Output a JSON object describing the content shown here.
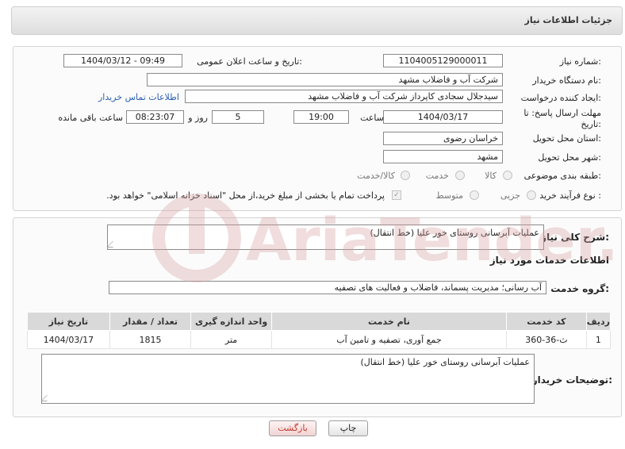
{
  "header": {
    "title": "جزئیات اطلاعات نیاز"
  },
  "form": {
    "need_number_label": "شماره نیاز:",
    "need_number": "1104005129000011",
    "announce_label": "تاریخ و ساعت اعلان عمومی:",
    "announce_value": "1404/03/12 - 09:49",
    "buyer_org_label": "نام دستگاه خریدار:",
    "buyer_org": "شرکت آب و فاضلاب مشهد",
    "creator_label": "ایجاد کننده درخواست:",
    "creator": "سیدجلال سجادی کاپرداز شرکت آب و فاضلاب مشهد",
    "contact_link": "اطلاعات تماس خریدار",
    "deadline_label_1": "مهلت ارسال پاسخ: تا",
    "deadline_label_2": "تاریخ:",
    "deadline_date": "1404/03/17",
    "time_label": "ساعت",
    "deadline_time": "19:00",
    "days_value": "5",
    "days_label": "روز و",
    "remaining_time": "08:23:07",
    "remaining_label": "ساعت باقی مانده",
    "province_label": "استان محل تحویل:",
    "province": "خراسان رضوی",
    "city_label": "شهر محل تحویل:",
    "city": "مشهد",
    "category_label": "طبقه بندی موضوعی:",
    "category_options": [
      "کالا",
      "خدمت",
      "کالا/خدمت"
    ],
    "process_label": "نوع فرآیند خرید :",
    "process_options": [
      "جزیی",
      "متوسط"
    ],
    "payment_note": "پرداخت تمام یا بخشی از مبلغ خرید،از محل \"اسناد خزانه اسلامی\" خواهد بود."
  },
  "summary": {
    "label": "شرح کلی نیاز:",
    "text": "عملیات آبرسانی روستای خور علیا (خط انتقال)"
  },
  "services": {
    "section_title": "اطلاعات خدمات مورد نیاز",
    "group_label": "گروه خدمت:",
    "group_value": "آب رسانی؛ مدیریت پسماند، فاضلاب و فعالیت های تصفیه",
    "table": {
      "headers": [
        "ردیف",
        "کد خدمت",
        "نام خدمت",
        "واحد اندازه گیری",
        "تعداد / مقدار",
        "تاریخ نیاز"
      ],
      "rows": [
        [
          "1",
          "ث-36-360",
          "جمع آوری، تصفیه و تامین آب",
          "متر",
          "1815",
          "1404/03/17"
        ]
      ]
    }
  },
  "buyer_notes": {
    "label": "توضیحات خریدار:",
    "text": "عملیات آبرسانی روستای خور علیا (خط انتقال)"
  },
  "buttons": {
    "print": "چاپ",
    "back": "بازگشت"
  },
  "watermark": {
    "text": "AriaTender.neT"
  },
  "colors": {
    "link": "#2a5fb0",
    "back_button_text": "#c0392b",
    "watermark": "#e8c4c4"
  }
}
